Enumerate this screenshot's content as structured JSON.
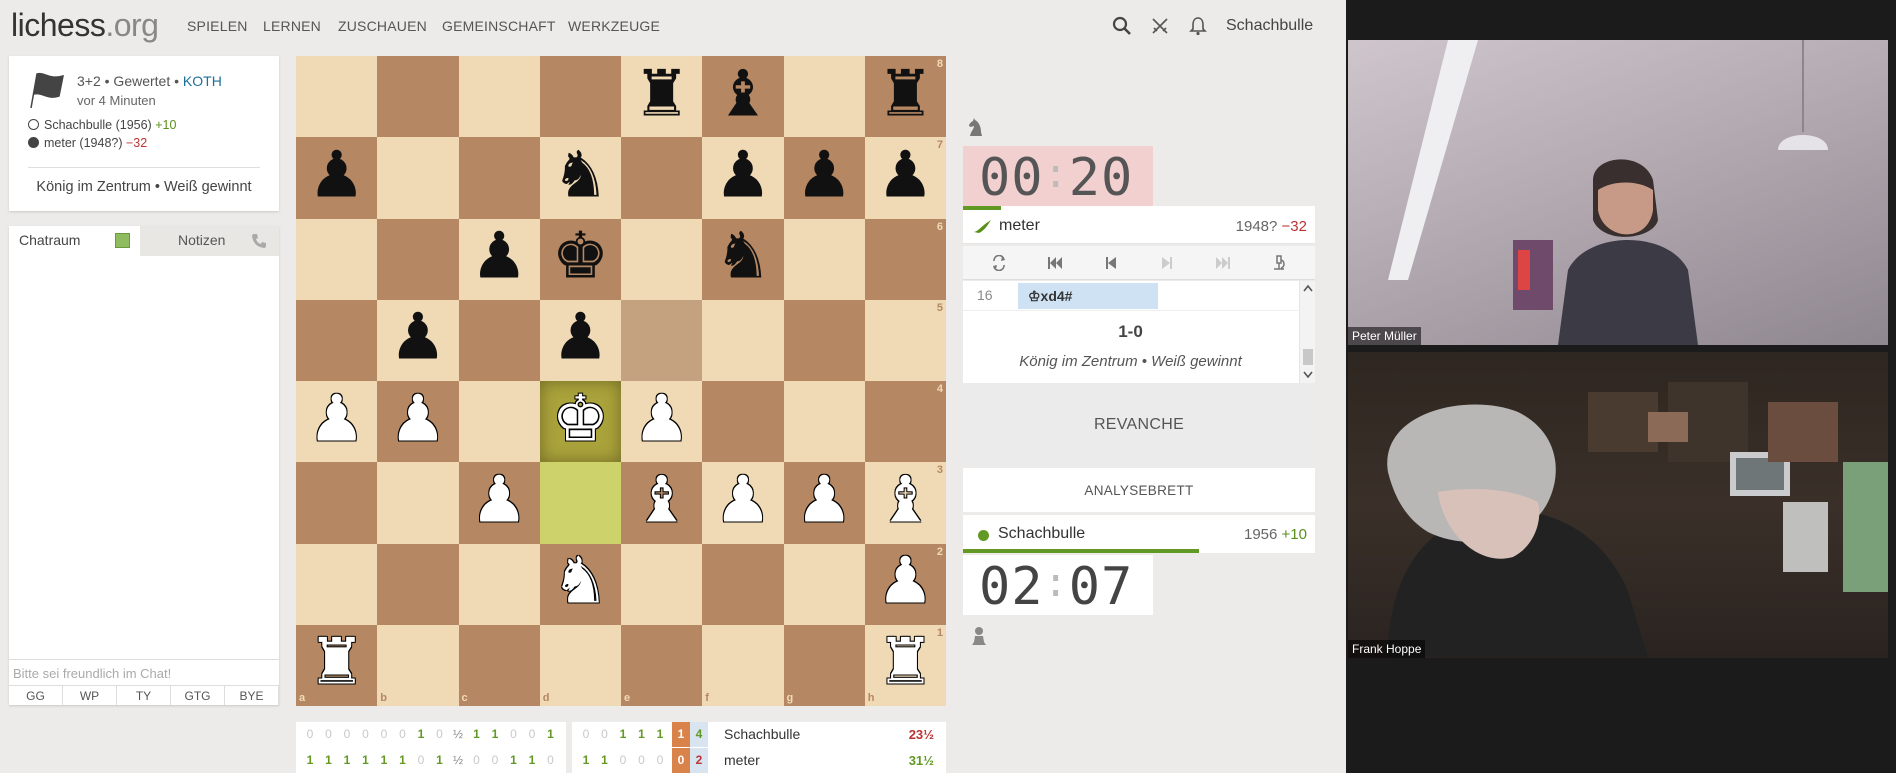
{
  "header": {
    "logo_main": "lichess",
    "logo_tld": ".org",
    "nav": [
      "SPIELEN",
      "LERNEN",
      "ZUSCHAUEN",
      "GEMEINSCHAFT",
      "WERKZEUGE"
    ],
    "username": "Schachbulle"
  },
  "game_meta": {
    "line1": "3+2 • Gewertet • ",
    "variant": "KOTH",
    "time_ago": "vor 4 Minuten",
    "white": {
      "name": "Schachbulle (1956)",
      "diff": "+10"
    },
    "black": {
      "name": "meter (1948?)",
      "diff": "−32"
    },
    "status": "König im Zentrum • Weiß gewinnt"
  },
  "chat": {
    "tab_chat": "Chatraum",
    "tab_notes": "Notizen",
    "placeholder": "Bitte sei freundlich im Chat!",
    "presets": [
      "GG",
      "WP",
      "TY",
      "GTG",
      "BYE"
    ]
  },
  "board": {
    "files": [
      "a",
      "b",
      "c",
      "d",
      "e",
      "f",
      "g",
      "h"
    ],
    "ranks": [
      "8",
      "7",
      "6",
      "5",
      "4",
      "3",
      "2",
      "1"
    ],
    "position": [
      "....rb.r",
      "p..n.ppp",
      "..pk.n..",
      ".p.p....",
      "PP.KP...",
      "..P.BPPB",
      "...N...P",
      "R......R"
    ],
    "last_move_from": "e5",
    "last_move_to": "d4",
    "highlight_square": "d3",
    "check_square": "d4"
  },
  "opponent": {
    "name": "meter",
    "rating": "1948?",
    "diff": "−32",
    "clock_min": "00",
    "clock_sec": "20"
  },
  "me": {
    "name": "Schachbulle",
    "rating": "1956",
    "diff": "+10",
    "clock_min": "02",
    "clock_sec": "07"
  },
  "moves": {
    "number": "16",
    "san": "♔xd4#",
    "result": "1-0",
    "result_text": "König im Zentrum • Weiß gewinnt"
  },
  "actions": {
    "rematch": "REVANCHE",
    "analysis": "ANALYSEBRETT"
  },
  "crosstable": {
    "row1": {
      "results": [
        "0",
        "0",
        "0",
        "0",
        "0",
        "0",
        "1",
        "0",
        "½",
        "1",
        "1",
        "0",
        "0",
        "1",
        "0",
        "0",
        "1",
        "1",
        "1",
        "1"
      ],
      "current": "4",
      "name": "Schachbulle",
      "score": "23½"
    },
    "row2": {
      "results": [
        "1",
        "1",
        "1",
        "1",
        "1",
        "1",
        "0",
        "1",
        "½",
        "0",
        "0",
        "1",
        "1",
        "0",
        "1",
        "1",
        "0",
        "0",
        "0",
        "0"
      ],
      "current": "2",
      "name": "meter",
      "score": "31½"
    }
  },
  "video": {
    "top_label": "Peter Müller",
    "bottom_label": "Frank Hoppe"
  }
}
